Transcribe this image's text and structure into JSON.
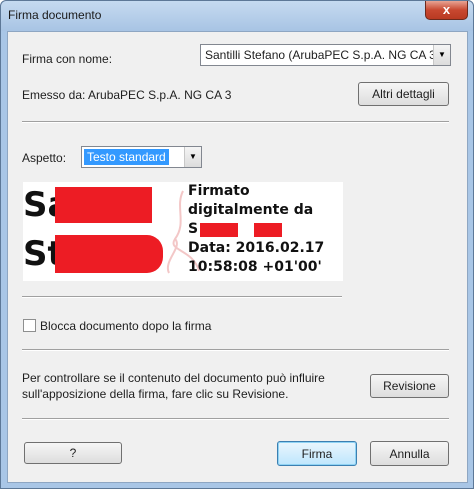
{
  "window": {
    "title": "Firma documento",
    "close_glyph": "x"
  },
  "signer": {
    "label": "Firma con nome:",
    "selected": "Santilli Stefano (ArubaPEC S.p.A. NG CA 3)",
    "issued_by": "Emesso da: ArubaPEC S.p.A. NG CA 3",
    "details_button": "Altri dettagli"
  },
  "appearance": {
    "label": "Aspetto:",
    "selected": "Testo standard"
  },
  "signature_preview": {
    "letters_line1": "Sa",
    "letters_line2": "St",
    "line1": "Firmato",
    "line2": "digitalmente da",
    "line3_prefix": "S",
    "line4": "Data: 2016.02.17",
    "line5": "10:58:08 +01'00'",
    "redaction_color": "#ed1c24"
  },
  "lock_option": {
    "label": "Blocca documento dopo la firma",
    "checked": false
  },
  "review": {
    "text_line1": "Per controllare se il contenuto del documento può influire",
    "text_line2": "sull'apposizione della firma, fare clic su Revisione.",
    "button": "Revisione"
  },
  "footer": {
    "help_button": "?",
    "sign_button": "Firma",
    "cancel_button": "Annulla"
  }
}
